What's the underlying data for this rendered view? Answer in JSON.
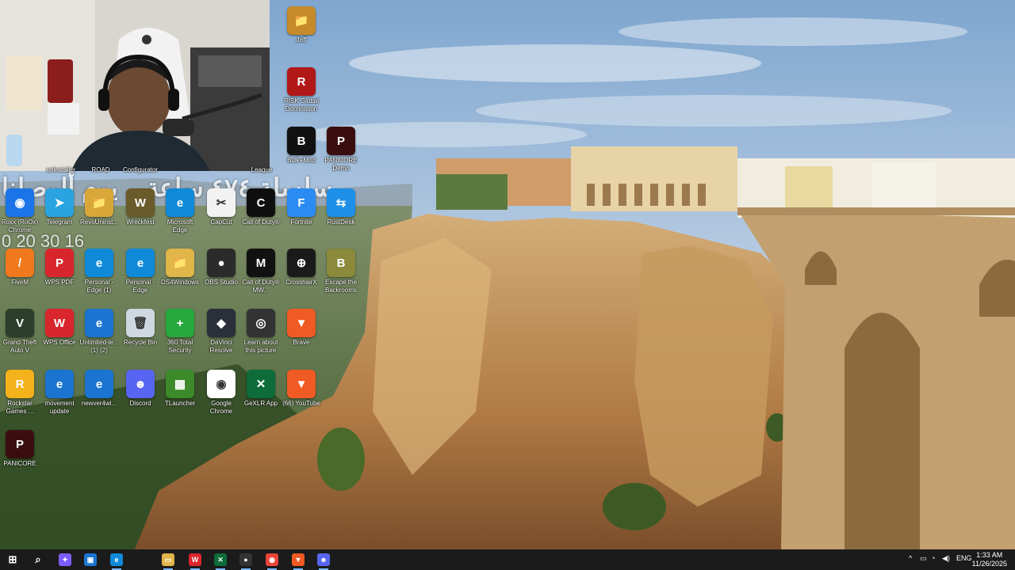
{
  "desktop": {
    "icons": [
      {
        "id": "jeff",
        "label": "Jeff",
        "bg": "#c58a2a",
        "glyph": "📁"
      },
      {
        "id": "risk",
        "label": "RISK Global Domination",
        "bg": "#b11818",
        "glyph": "R"
      },
      {
        "id": "bulk",
        "label": "Bulk+Mod",
        "bg": "#111111",
        "glyph": "B"
      },
      {
        "id": "panicore-demo",
        "label": "PANICORE Demo",
        "bg": "#3a0e0e",
        "glyph": "P"
      },
      {
        "id": "unk1",
        "label": "unInstaller",
        "bg": "#2f6fd1",
        "glyph": "?"
      },
      {
        "id": "unk2",
        "label": "ROAD",
        "bg": "#555555",
        "glyph": "?"
      },
      {
        "id": "configurator",
        "label": "Configurator",
        "bg": "#333333",
        "glyph": "?"
      },
      {
        "id": "league",
        "label": "League",
        "bg": "#1b3c6b",
        "glyph": "?"
      },
      {
        "id": "roxx",
        "label": "Roxx (RoOx) Chrome",
        "bg": "#1b74e8",
        "glyph": "◉"
      },
      {
        "id": "telegram",
        "label": "Telegram",
        "bg": "#2aa3e0",
        "glyph": "➤"
      },
      {
        "id": "revo",
        "label": "RevoUninst...",
        "bg": "#d7a73a",
        "glyph": "📁"
      },
      {
        "id": "wreckfest",
        "label": "Wreckfest",
        "bg": "#6b5a2a",
        "glyph": "W"
      },
      {
        "id": "edge",
        "label": "Microsoft Edge",
        "bg": "#0f8ad8",
        "glyph": "e"
      },
      {
        "id": "capcut",
        "label": "CapCut",
        "bg": "#f2f2f2",
        "glyph": "✂"
      },
      {
        "id": "cod",
        "label": "Call of Duty®",
        "bg": "#0f0f0f",
        "glyph": "C"
      },
      {
        "id": "fortnite",
        "label": "Fortnite",
        "bg": "#2a8cf2",
        "glyph": "F"
      },
      {
        "id": "rustdesk",
        "label": "RustDesk",
        "bg": "#1e90e8",
        "glyph": "⇆"
      },
      {
        "id": "fivem",
        "label": "FiveM",
        "bg": "#f0791e",
        "glyph": "/"
      },
      {
        "id": "wpspdf",
        "label": "WPS PDF",
        "bg": "#d8262c",
        "glyph": "P"
      },
      {
        "id": "personal1",
        "label": "Personal - Edge (1)",
        "bg": "#0f8ad8",
        "glyph": "e"
      },
      {
        "id": "personal2",
        "label": "Personal - Edge",
        "bg": "#0f8ad8",
        "glyph": "e"
      },
      {
        "id": "ds4",
        "label": "DS4Windows",
        "bg": "#e0b54a",
        "glyph": "📁"
      },
      {
        "id": "obs",
        "label": "OBS Studio",
        "bg": "#2b2b2b",
        "glyph": "●"
      },
      {
        "id": "mw3",
        "label": "Call of Duty® MW...",
        "bg": "#111111",
        "glyph": "M"
      },
      {
        "id": "crosshairx",
        "label": "CrosshairX",
        "bg": "#1a1a1a",
        "glyph": "⊕"
      },
      {
        "id": "backrooms",
        "label": "Escape the Backrooms",
        "bg": "#8a8a3a",
        "glyph": "B"
      },
      {
        "id": "gta",
        "label": "Grand Theft Auto V",
        "bg": "#2c3e2c",
        "glyph": "V"
      },
      {
        "id": "wpsoffice",
        "label": "WPS Office",
        "bg": "#d8262c",
        "glyph": "W"
      },
      {
        "id": "unlimited",
        "label": "Unlimited-le... (1) (2)",
        "bg": "#1b75d0",
        "glyph": "e"
      },
      {
        "id": "recycle",
        "label": "Recycle Bin",
        "bg": "#cfd8e0",
        "glyph": "🗑"
      },
      {
        "id": "360",
        "label": "360 Total Security",
        "bg": "#27a83c",
        "glyph": "+"
      },
      {
        "id": "davinci",
        "label": "DaVinci Resolve",
        "bg": "#2a2f3a",
        "glyph": "◆"
      },
      {
        "id": "learn",
        "label": "Learn about this picture",
        "bg": "#333333",
        "glyph": "◎"
      },
      {
        "id": "brave",
        "label": "Brave",
        "bg": "#f05a23",
        "glyph": "▼"
      },
      {
        "id": "rockstar",
        "label": "Rockstar Games ...",
        "bg": "#f4b21b",
        "glyph": "R"
      },
      {
        "id": "movement",
        "label": "movement update",
        "bg": "#1b75d0",
        "glyph": "e"
      },
      {
        "id": "newver",
        "label": "newver4wi...",
        "bg": "#1b75d0",
        "glyph": "e"
      },
      {
        "id": "discord",
        "label": "Discord",
        "bg": "#5865f2",
        "glyph": "☻"
      },
      {
        "id": "tlauncher",
        "label": "TLauncher",
        "bg": "#3c8a2a",
        "glyph": "▦"
      },
      {
        "id": "chrome",
        "label": "Google Chrome",
        "bg": "#ffffff",
        "glyph": "◉"
      },
      {
        "id": "gexlr",
        "label": "GeXLR App",
        "bg": "#0e6b3a",
        "glyph": "✕"
      },
      {
        "id": "youtube",
        "label": "(66) YouTube",
        "bg": "#f05a23",
        "glyph": "▼"
      },
      {
        "id": "panicore",
        "label": "PANICORE",
        "bg": "#3a0e0e",
        "glyph": "P"
      }
    ]
  },
  "overlay": {
    "title": "سلسلة ٤٧٤ ساعة .. يوم ألوصلنا",
    "timer": "0 20 30 16"
  },
  "taskbar": {
    "buttons": [
      {
        "id": "start",
        "glyph": "⊞",
        "bg": "transparent"
      },
      {
        "id": "search",
        "glyph": "⌕",
        "bg": "transparent"
      },
      {
        "id": "copilot",
        "glyph": "✦",
        "bg": "#7b5cff"
      },
      {
        "id": "store",
        "glyph": "▣",
        "bg": "#1b75d0"
      },
      {
        "id": "edge",
        "glyph": "e",
        "bg": "#0f8ad8"
      },
      {
        "id": "explorer",
        "glyph": "▭",
        "bg": "#e0b54a"
      },
      {
        "id": "wps",
        "glyph": "W",
        "bg": "#d8262c"
      },
      {
        "id": "gexlr",
        "glyph": "✕",
        "bg": "#0e6b3a"
      },
      {
        "id": "obs",
        "glyph": "●",
        "bg": "#333333"
      },
      {
        "id": "chrome",
        "glyph": "◉",
        "bg": "#e8443a"
      },
      {
        "id": "brave",
        "glyph": "▼",
        "bg": "#f05a23"
      },
      {
        "id": "discord",
        "glyph": "☻",
        "bg": "#5865f2"
      }
    ],
    "tray": {
      "chevron": "^",
      "lang": "ENG",
      "time": "1:33 AM",
      "date": "11/26/2025"
    }
  },
  "colors": {
    "sky": "#9bb8d8",
    "cliff": "#c9a06a",
    "building": "#e8d7b3",
    "taskbar": "#1b1b1b"
  }
}
